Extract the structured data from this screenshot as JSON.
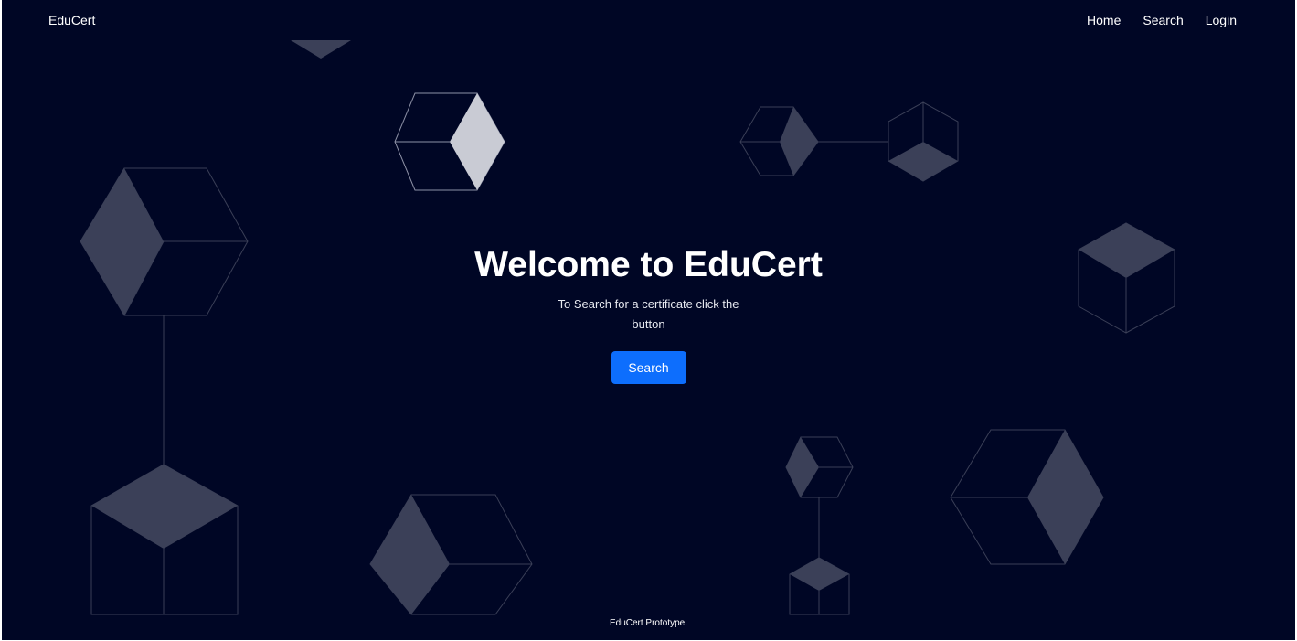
{
  "navbar": {
    "brand": "EduCert",
    "links": [
      "Home",
      "Search",
      "Login"
    ]
  },
  "hero": {
    "title": "Welcome to EduCert",
    "subtitle": "To Search for a certificate click the button",
    "button_label": "Search"
  },
  "footer": {
    "text": "EduCert Prototype."
  },
  "colors": {
    "background": "#000625",
    "accent": "#0d6efd",
    "cube_face": "#3b4058",
    "cube_face_light": "#c9cbd4",
    "cube_outline": "#3a3f57"
  },
  "decorations": {
    "icon": "isometric-cube-icon"
  }
}
